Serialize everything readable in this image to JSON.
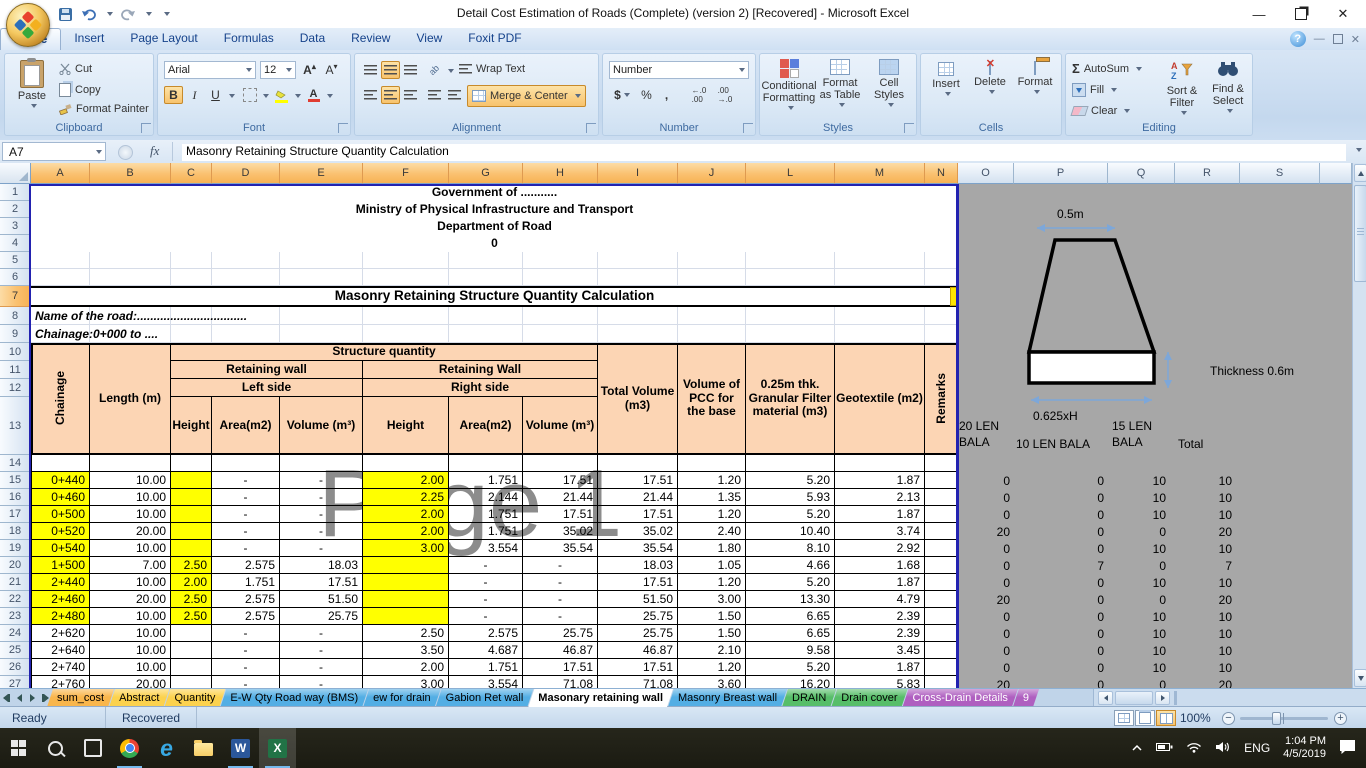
{
  "titlebar": {
    "title": "Detail Cost Estimation of  Roads (Complete) (version 2) [Recovered]  -  Microsoft Excel"
  },
  "ribbon": {
    "tabs": [
      {
        "label": "Home",
        "active": true
      },
      {
        "label": "Insert"
      },
      {
        "label": "Page Layout"
      },
      {
        "label": "Formulas"
      },
      {
        "label": "Data"
      },
      {
        "label": "Review"
      },
      {
        "label": "View"
      },
      {
        "label": "Foxit PDF"
      }
    ],
    "clipboard": {
      "label": "Clipboard",
      "paste": "Paste",
      "cut": "Cut",
      "copy": "Copy",
      "format_painter": "Format Painter"
    },
    "font": {
      "label": "Font",
      "family": "Arial",
      "size": "12"
    },
    "alignment": {
      "label": "Alignment",
      "wrap_text": "Wrap Text",
      "merge_center": "Merge & Center"
    },
    "number": {
      "label": "Number",
      "format": "Number"
    },
    "styles": {
      "label": "Styles",
      "conditional": "Conditional Formatting",
      "format_table": "Format as Table",
      "cell_styles": "Cell Styles"
    },
    "cells": {
      "label": "Cells",
      "insert": "Insert",
      "delete": "Delete",
      "format": "Format"
    },
    "editing": {
      "label": "Editing",
      "autosum": "AutoSum",
      "fill": "Fill",
      "clear": "Clear",
      "sort": "Sort & Filter",
      "find": "Find & Select"
    }
  },
  "formula_bar": {
    "name_box": "A7",
    "value": "Masonry Retaining Structure Quantity Calculation"
  },
  "sheet": {
    "columns": [
      "A",
      "B",
      "C",
      "D",
      "E",
      "F",
      "G",
      "H",
      "I",
      "J",
      "L",
      "M",
      "N"
    ],
    "gray_columns": [
      "O",
      "P",
      "Q",
      "R",
      "S"
    ],
    "doc_header": [
      "Government of ...........",
      "Ministry of Physical Infrastructure and Transport",
      "Department of Road",
      "0"
    ],
    "section_title": "Masonry Retaining Structure Quantity Calculation",
    "road_name": "Name of the road:.................................",
    "chainage_range": "Chainage:0+000 to ....",
    "watermark": "Page 1",
    "table_header": {
      "chainage": "Chainage",
      "length": "Length (m)",
      "structure_quantity": "Structure quantity",
      "retaining_wall_left": "Retaining wall",
      "left_side": "Left side",
      "retaining_wall_right": "Retaining Wall",
      "right_side": "Right side",
      "height": "Height",
      "area": "Area(m2)",
      "volume": "Volume (m³)",
      "total_volume": "Total Volume (m3)",
      "pcc": "Volume of PCC for the base",
      "granular": "0.25m thk. Granular Filter material (m3)",
      "geotextile": "Geotextile (m2)",
      "remarks": "Remarks"
    },
    "highlight_rows": 9,
    "rows": [
      [
        "0+440",
        "10.00",
        "",
        "-",
        "-",
        "2.00",
        "1.751",
        "17.51",
        "17.51",
        "1.20",
        "5.20",
        "1.87"
      ],
      [
        "0+460",
        "10.00",
        "",
        "-",
        "-",
        "2.25",
        "2.144",
        "21.44",
        "21.44",
        "1.35",
        "5.93",
        "2.13"
      ],
      [
        "0+500",
        "10.00",
        "",
        "-",
        "-",
        "2.00",
        "1.751",
        "17.51",
        "17.51",
        "1.20",
        "5.20",
        "1.87"
      ],
      [
        "0+520",
        "20.00",
        "",
        "-",
        "-",
        "2.00",
        "1.751",
        "35.02",
        "35.02",
        "2.40",
        "10.40",
        "3.74"
      ],
      [
        "0+540",
        "10.00",
        "",
        "-",
        "-",
        "3.00",
        "3.554",
        "35.54",
        "35.54",
        "1.80",
        "8.10",
        "2.92"
      ],
      [
        "1+500",
        "7.00",
        "2.50",
        "2.575",
        "18.03",
        "",
        "-",
        "-",
        "18.03",
        "1.05",
        "4.66",
        "1.68"
      ],
      [
        "2+440",
        "10.00",
        "2.00",
        "1.751",
        "17.51",
        "",
        "-",
        "-",
        "17.51",
        "1.20",
        "5.20",
        "1.87"
      ],
      [
        "2+460",
        "20.00",
        "2.50",
        "2.575",
        "51.50",
        "",
        "-",
        "-",
        "51.50",
        "3.00",
        "13.30",
        "4.79"
      ],
      [
        "2+480",
        "10.00",
        "2.50",
        "2.575",
        "25.75",
        "",
        "-",
        "-",
        "25.75",
        "1.50",
        "6.65",
        "2.39"
      ],
      [
        "2+620",
        "10.00",
        "",
        "-",
        "-",
        "2.50",
        "2.575",
        "25.75",
        "25.75",
        "1.50",
        "6.65",
        "2.39"
      ],
      [
        "2+640",
        "10.00",
        "",
        "-",
        "-",
        "3.50",
        "4.687",
        "46.87",
        "46.87",
        "2.10",
        "9.58",
        "3.45"
      ],
      [
        "2+740",
        "10.00",
        "",
        "-",
        "-",
        "2.00",
        "1.751",
        "17.51",
        "17.51",
        "1.20",
        "5.20",
        "1.87"
      ],
      [
        "2+760",
        "20.00",
        "",
        "-",
        "-",
        "3.00",
        "3.554",
        "71.08",
        "71.08",
        "3.60",
        "16.20",
        "5.83"
      ]
    ]
  },
  "side_panel": {
    "top_width": "0.5m",
    "bottom_width": "0.625xH",
    "thickness": "Thickness 0.6m",
    "col_headers": [
      [
        "20 LEN",
        "BALA"
      ],
      [
        "10 LEN BALA"
      ],
      [
        "15 LEN",
        "BALA"
      ],
      [
        "Total"
      ]
    ],
    "values": [
      [
        "0",
        "0",
        "10",
        "10"
      ],
      [
        "0",
        "0",
        "10",
        "10"
      ],
      [
        "0",
        "0",
        "10",
        "10"
      ],
      [
        "20",
        "0",
        "0",
        "20"
      ],
      [
        "0",
        "0",
        "10",
        "10"
      ],
      [
        "0",
        "7",
        "0",
        "7"
      ],
      [
        "0",
        "0",
        "10",
        "10"
      ],
      [
        "20",
        "0",
        "0",
        "20"
      ],
      [
        "0",
        "0",
        "10",
        "10"
      ],
      [
        "0",
        "0",
        "10",
        "10"
      ],
      [
        "0",
        "0",
        "10",
        "10"
      ],
      [
        "0",
        "0",
        "10",
        "10"
      ],
      [
        "20",
        "0",
        "0",
        "20"
      ]
    ]
  },
  "sheet_tabs": [
    {
      "label": "sum_cost",
      "color": "#F9B64C"
    },
    {
      "label": "Abstract",
      "color": "#FCD24E"
    },
    {
      "label": "Quantity",
      "color": "#FCD24E"
    },
    {
      "label": "E-W Qty Road way (BMS)",
      "color": "#53AEE4"
    },
    {
      "label": "ew for drain",
      "color": "#53AEE4"
    },
    {
      "label": "Gabion Ret wall",
      "color": "#53AEE4"
    },
    {
      "label": "Masonary retaining wall",
      "active": true
    },
    {
      "label": "Masonry Breast wall",
      "color": "#53AEE4"
    },
    {
      "label": "DRAIN",
      "color": "#57BE69"
    },
    {
      "label": "Drain cover",
      "color": "#57BE69"
    },
    {
      "label": "Cross-Drain Details",
      "color": "#AF5FC0",
      "light_text": true
    },
    {
      "label": "9",
      "color": "#AF5FC0",
      "light_text": true
    }
  ],
  "status_bar": {
    "ready": "Ready",
    "recovered": "Recovered",
    "zoom": "100%"
  },
  "taskbar": {
    "language": "ENG",
    "time": "1:04 PM",
    "date": "4/5/2019"
  }
}
